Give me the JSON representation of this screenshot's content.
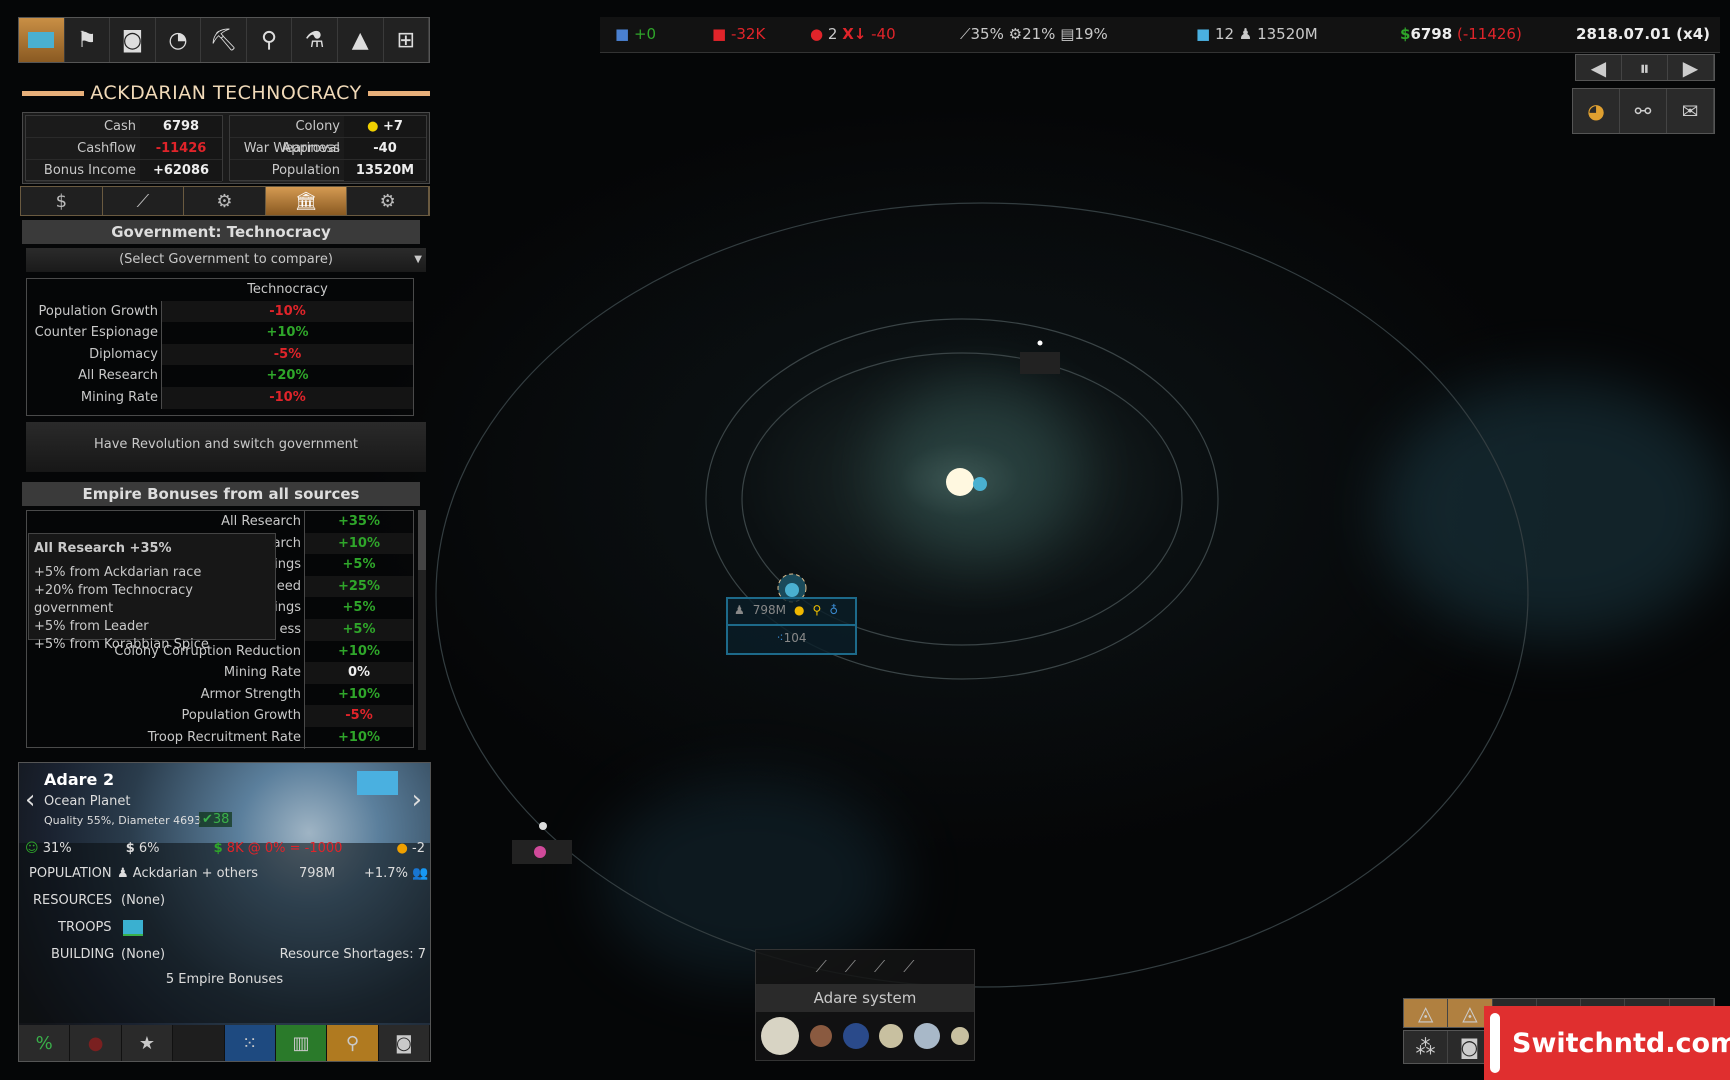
{
  "top_icons": [
    {
      "icon": "empire-flag-icon"
    },
    {
      "icon": "diplomacy-flags-icon"
    },
    {
      "icon": "planet-flag-icon"
    },
    {
      "icon": "radar-icon"
    },
    {
      "icon": "pickaxe-icon"
    },
    {
      "icon": "crane-hook-icon"
    },
    {
      "icon": "flask-icon"
    },
    {
      "icon": "fleet-icon"
    },
    {
      "icon": "troops-icon"
    }
  ],
  "empire": {
    "title": "ACKDARIAN TECHNOCRACY",
    "stats_left": [
      {
        "label": "Cash",
        "value": "6798"
      },
      {
        "label": "Cashflow",
        "value": "-11426"
      },
      {
        "label": "Bonus Income",
        "value": "+62086"
      }
    ],
    "stats_right": [
      {
        "label": "Colony Approval",
        "value": "+7"
      },
      {
        "label": "War Weariness",
        "value": "-40"
      },
      {
        "label": "Population",
        "value": "13520M"
      }
    ]
  },
  "tabs": [
    {
      "icon": "dollar-icon"
    },
    {
      "icon": "chart-icon"
    },
    {
      "icon": "gear-dollar-icon"
    },
    {
      "icon": "government-icon",
      "active": true
    },
    {
      "icon": "shield-gear-icon"
    }
  ],
  "government": {
    "header": "Government: Technocracy",
    "select_placeholder": "(Select Government to compare)",
    "column": "Technocracy",
    "rows": [
      {
        "label": "Population Growth",
        "value": "-10%"
      },
      {
        "label": "Counter Espionage",
        "value": "+10%"
      },
      {
        "label": "Diplomacy",
        "value": "-5%"
      },
      {
        "label": "All Research",
        "value": "+20%"
      },
      {
        "label": "Mining Rate",
        "value": "-10%"
      }
    ],
    "revolution_button": "Have Revolution and switch government"
  },
  "bonuses": {
    "header": "Empire Bonuses from all sources",
    "rows": [
      {
        "label": "All Research",
        "value": "+35%"
      },
      {
        "label": "arch",
        "value": "+10%"
      },
      {
        "label": "ings",
        "value": "+5%"
      },
      {
        "label": "eed",
        "value": "+25%"
      },
      {
        "label": "ings",
        "value": "+5%"
      },
      {
        "label": "ess",
        "value": "+5%"
      },
      {
        "label": "Colony Corruption Reduction",
        "value": "+10%"
      },
      {
        "label": "Mining Rate",
        "value": "0%"
      },
      {
        "label": "Armor Strength",
        "value": "+10%"
      },
      {
        "label": "Population Growth",
        "value": "-5%"
      },
      {
        "label": "Troop Recruitment Rate",
        "value": "+10%"
      }
    ],
    "tooltip": {
      "title": "All Research +35%",
      "lines": [
        "+5% from Ackdarian race",
        "+20% from Technocracy government",
        "+5% from Leader",
        "+5% from Korabbian Spice"
      ]
    }
  },
  "planet": {
    "name": "Adare 2",
    "type": "Ocean Planet",
    "quality": "Quality 55%, Diameter 4693",
    "defense": "38",
    "happiness": "31%",
    "tax": "6%",
    "income": "8K @ 0% = -1000",
    "mood": "-2",
    "population_label": "POPULATION",
    "population_race": "Ackdarian + others",
    "population_value": "798M",
    "population_growth": "+1.7%",
    "resources_label": "RESOURCES",
    "resources_value": "(None)",
    "troops_label": "TROOPS",
    "building_label": "BUILDING",
    "building_value": "(None)",
    "shortages": "Resource Shortages: 7",
    "empire_bonuses": "5 Empire Bonuses"
  },
  "topbar": {
    "a": "+0",
    "b": "-32K",
    "c": "2",
    "d": "-40",
    "e": "35%",
    "f": "21%",
    "g": "19%",
    "h": "12",
    "i": "13520M",
    "cash": "6798",
    "cashflow": "(-11426)",
    "date": "2818.07.01 (x4)"
  },
  "map_marker": {
    "population": "798M",
    "troops": "104"
  },
  "system": {
    "name": "Adare system"
  },
  "watermark": "Switchntd.com",
  "colors": {
    "accent": "#c98f45",
    "positive": "#2fa62a",
    "negative": "#e0242a",
    "marker": "#1d6a8a"
  }
}
